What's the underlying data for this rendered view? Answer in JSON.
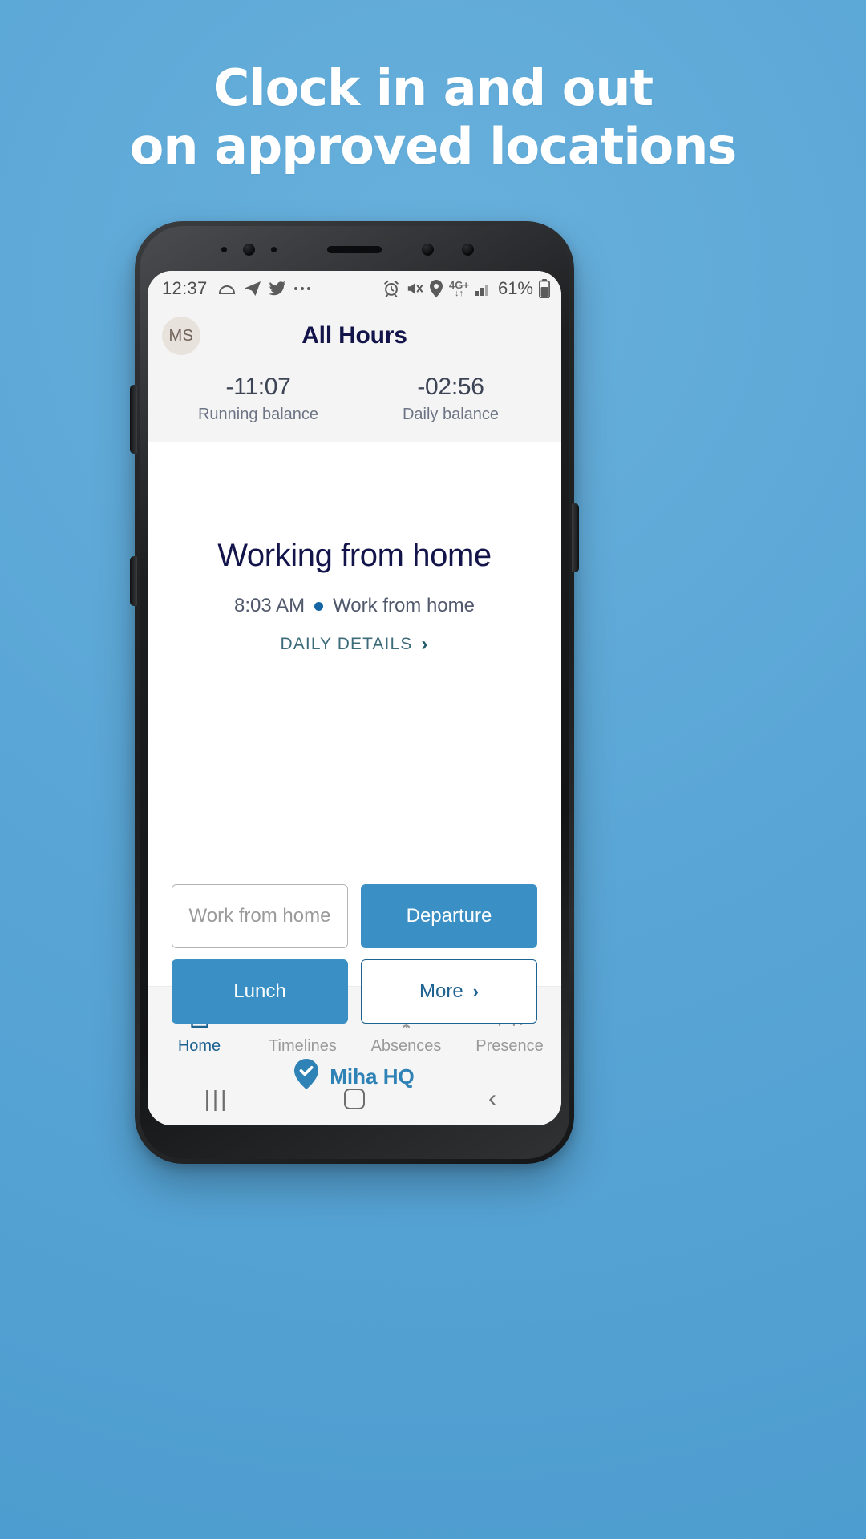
{
  "promo": {
    "background_color": "#5aa6d6",
    "headline_line1": "Clock in and out",
    "headline_line2": "on approved locations",
    "headline_color": "#ffffff"
  },
  "phone": {
    "status_bar": {
      "clock": "12:37",
      "left_icons": [
        "cloud-icon",
        "telegram-icon",
        "twitter-icon",
        "more-dots-icon"
      ],
      "right_icons": [
        "alarm-icon",
        "mute-icon",
        "location-icon"
      ],
      "network_label": "4G+",
      "network_arrows": "↓↑",
      "signal_icon": "signal-bars-icon",
      "battery_percent": "61%",
      "battery_icon": "battery-icon"
    },
    "app_header": {
      "avatar_initials": "MS",
      "title": "All Hours"
    },
    "balances": [
      {
        "value": "-11:07",
        "label": "Running balance"
      },
      {
        "value": "-02:56",
        "label": "Daily balance"
      }
    ],
    "main": {
      "status_title": "Working from home",
      "status_time": "8:03 AM",
      "status_separator": "•",
      "status_activity": "Work from home",
      "details_link": "DAILY DETAILS",
      "details_chevron": "›"
    },
    "actions": [
      {
        "label": "Work from home",
        "style": "outline-muted"
      },
      {
        "label": "Departure",
        "style": "filled"
      },
      {
        "label": "Lunch",
        "style": "filled"
      },
      {
        "label": "More",
        "style": "outline-primary",
        "chevron": "›"
      }
    ],
    "location": {
      "icon": "verified-location-pin-icon",
      "label": "Miha HQ",
      "color": "#2f82b5"
    },
    "tabs": [
      {
        "label": "Home",
        "icon": "home-icon",
        "active": true
      },
      {
        "label": "Timelines",
        "icon": "list-lines-icon",
        "active": false
      },
      {
        "label": "Absences",
        "icon": "beach-umbrella-icon",
        "active": false
      },
      {
        "label": "Presence",
        "icon": "people-group-icon",
        "active": false
      }
    ],
    "nav_bar": {
      "recents": "|||",
      "home": "home-square-icon",
      "back": "‹"
    }
  },
  "colors": {
    "accent_blue": "#3a8fc4",
    "primary_dark": "#1d6291",
    "navy": "#131449",
    "muted": "#9a9a9a"
  }
}
